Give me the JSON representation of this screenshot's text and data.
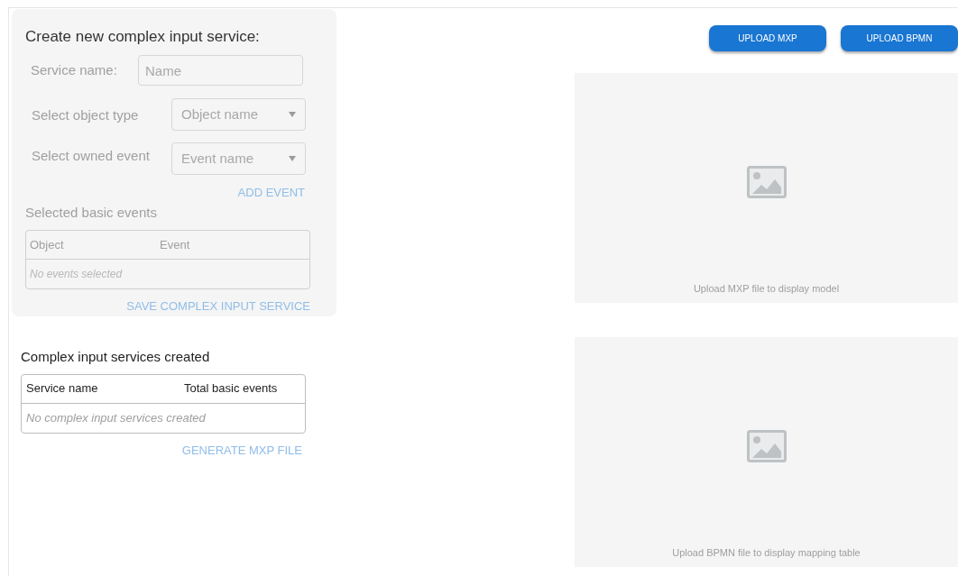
{
  "create_form": {
    "title": "Create new complex input service:",
    "disabled": true,
    "service_name": {
      "label": "Service name:",
      "placeholder": "Name"
    },
    "object_type": {
      "label": "Select object type",
      "placeholder": "Object name"
    },
    "owned_event": {
      "label": "Select owned event",
      "placeholder": "Event name"
    },
    "add_button": "ADD EVENT",
    "selected_events": {
      "title": "Selected basic events",
      "columns": [
        "Object",
        "Event"
      ],
      "empty": "No events selected"
    },
    "save_button": "SAVE COMPLEX INPUT SERVICE"
  },
  "services": {
    "title": "Complex input services created",
    "columns": [
      "Service name",
      "Total basic events"
    ],
    "empty": "No complex input services created",
    "generate_button": "GENERATE MXP FILE",
    "generate_disabled": true
  },
  "upload_buttons": [
    "UPLOAD MXP",
    "UPLOAD BPMN"
  ],
  "panels": [
    {
      "caption": "Upload MXP file to display model"
    },
    {
      "caption": "Upload BPMN file to display mapping table"
    }
  ]
}
